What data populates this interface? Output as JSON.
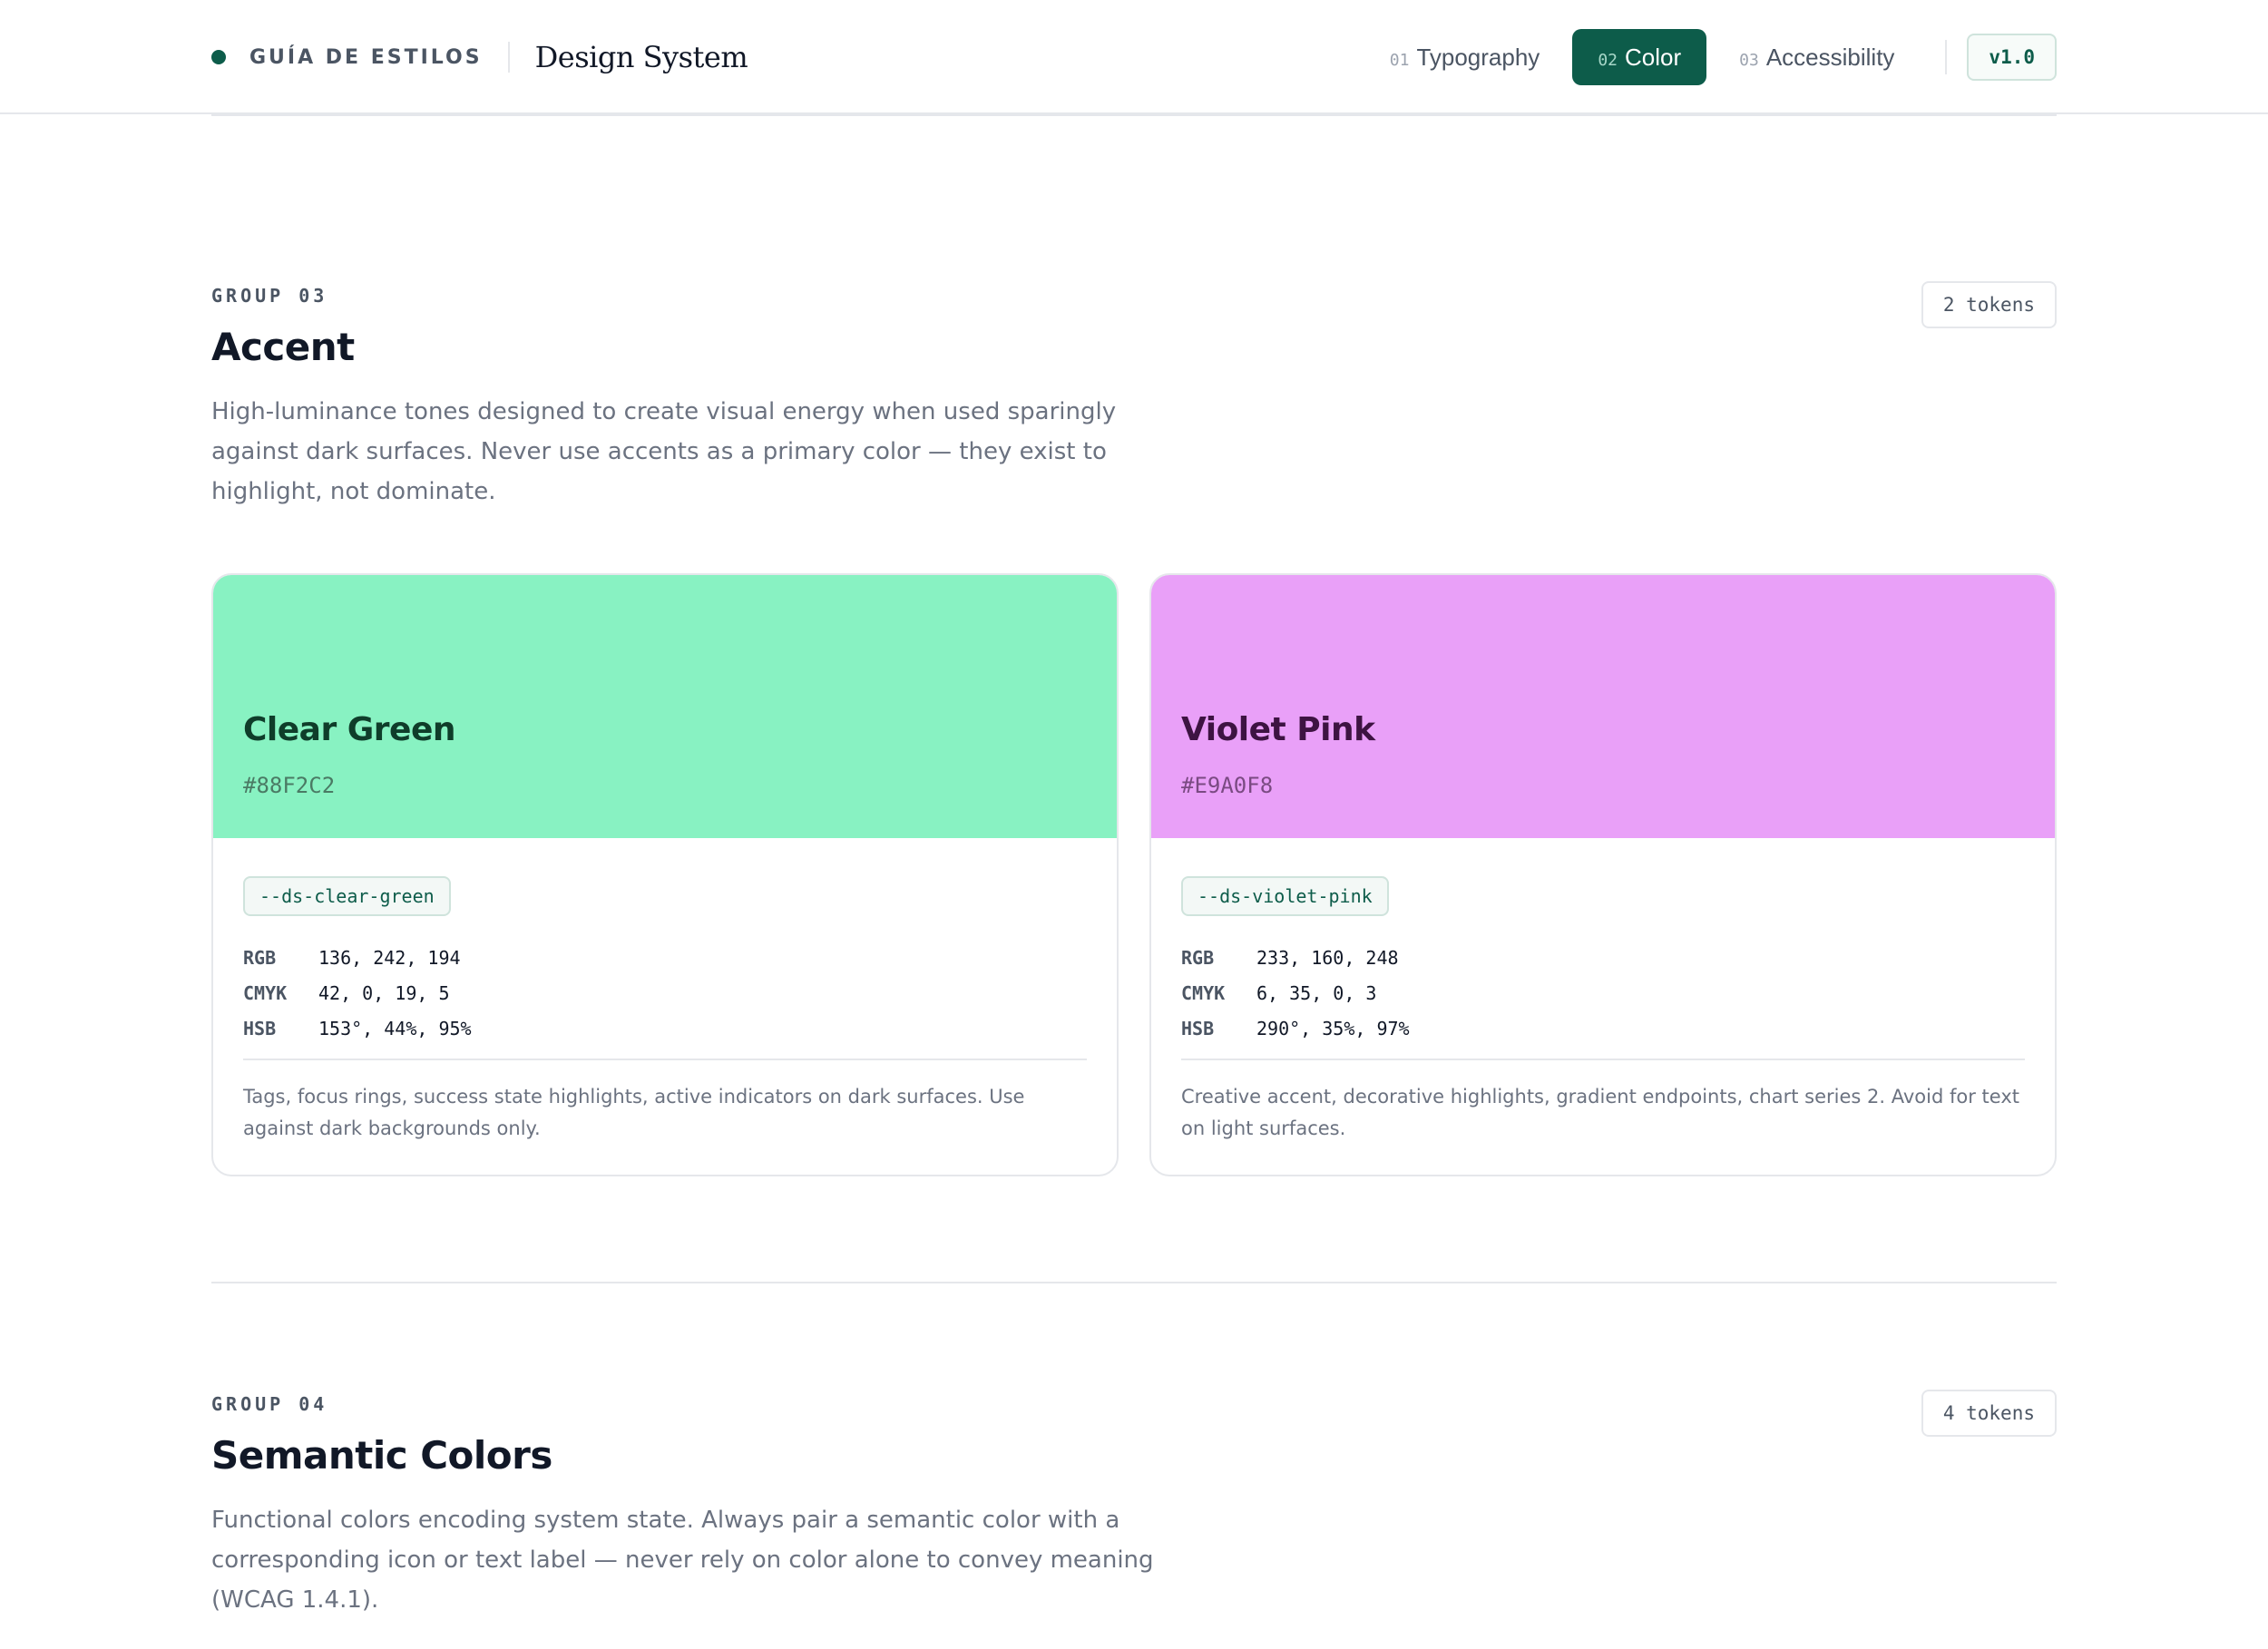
{
  "header": {
    "kicker": "GUÍA DE ESTILOS",
    "title": "Design System",
    "nav": [
      {
        "num": "01",
        "label": "Typography"
      },
      {
        "num": "02",
        "label": "Color"
      },
      {
        "num": "03",
        "label": "Accessibility"
      }
    ],
    "version": "v1.0"
  },
  "accent": {
    "group_label": "GROUP 03",
    "title": "Accent",
    "description": "High-luminance tones designed to create visual energy when used sparingly against dark surfaces. Never use accents as a primary color — they exist to highlight, not dominate.",
    "token_count": "2 tokens",
    "cards": [
      {
        "name": "Clear Green",
        "hex": "#88F2C2",
        "swatch_color": "#88F2C2",
        "name_color": "#0f3d2a",
        "hex_color": "#4a7a64",
        "css_var": "--ds-clear-green",
        "specs": [
          {
            "key": "RGB",
            "value": "136, 242, 194"
          },
          {
            "key": "CMYK",
            "value": "42, 0, 19, 5"
          },
          {
            "key": "HSB",
            "value": "153°, 44%, 95%"
          }
        ],
        "note": "Tags, focus rings, success state highlights, active indicators on dark surfaces. Use against dark backgrounds only."
      },
      {
        "name": "Violet Pink",
        "hex": "#E9A0F8",
        "swatch_color": "#E9A0F8",
        "name_color": "#3d1342",
        "hex_color": "#7a4a82",
        "css_var": "--ds-violet-pink",
        "specs": [
          {
            "key": "RGB",
            "value": "233, 160, 248"
          },
          {
            "key": "CMYK",
            "value": "6, 35, 0, 3"
          },
          {
            "key": "HSB",
            "value": "290°, 35%, 97%"
          }
        ],
        "note": "Creative accent, decorative highlights, gradient endpoints, chart series 2. Avoid for text on light surfaces."
      }
    ]
  },
  "semantic": {
    "group_label": "GROUP 04",
    "title": "Semantic Colors",
    "description": "Functional colors encoding system state. Always pair a semantic color with a corresponding icon or text label — never rely on color alone to convey meaning (WCAG 1.4.1).",
    "token_count": "4 tokens"
  },
  "colors": {
    "primary": "#0d5c4a",
    "border": "#e5e7eb",
    "muted_text": "#6b7280"
  }
}
